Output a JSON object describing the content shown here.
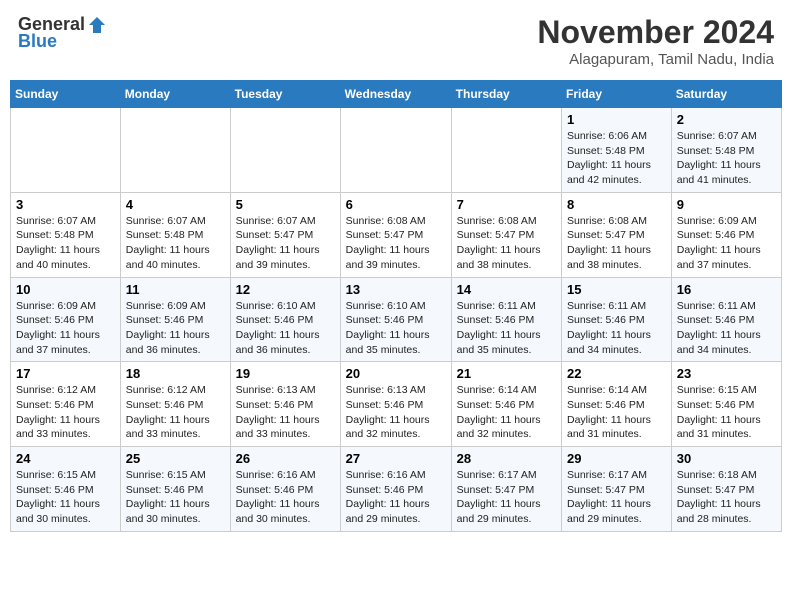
{
  "header": {
    "logo_general": "General",
    "logo_blue": "Blue",
    "month": "November 2024",
    "location": "Alagapuram, Tamil Nadu, India"
  },
  "weekdays": [
    "Sunday",
    "Monday",
    "Tuesday",
    "Wednesday",
    "Thursday",
    "Friday",
    "Saturday"
  ],
  "weeks": [
    [
      {
        "day": "",
        "info": ""
      },
      {
        "day": "",
        "info": ""
      },
      {
        "day": "",
        "info": ""
      },
      {
        "day": "",
        "info": ""
      },
      {
        "day": "",
        "info": ""
      },
      {
        "day": "1",
        "info": "Sunrise: 6:06 AM\nSunset: 5:48 PM\nDaylight: 11 hours\nand 42 minutes."
      },
      {
        "day": "2",
        "info": "Sunrise: 6:07 AM\nSunset: 5:48 PM\nDaylight: 11 hours\nand 41 minutes."
      }
    ],
    [
      {
        "day": "3",
        "info": "Sunrise: 6:07 AM\nSunset: 5:48 PM\nDaylight: 11 hours\nand 40 minutes."
      },
      {
        "day": "4",
        "info": "Sunrise: 6:07 AM\nSunset: 5:48 PM\nDaylight: 11 hours\nand 40 minutes."
      },
      {
        "day": "5",
        "info": "Sunrise: 6:07 AM\nSunset: 5:47 PM\nDaylight: 11 hours\nand 39 minutes."
      },
      {
        "day": "6",
        "info": "Sunrise: 6:08 AM\nSunset: 5:47 PM\nDaylight: 11 hours\nand 39 minutes."
      },
      {
        "day": "7",
        "info": "Sunrise: 6:08 AM\nSunset: 5:47 PM\nDaylight: 11 hours\nand 38 minutes."
      },
      {
        "day": "8",
        "info": "Sunrise: 6:08 AM\nSunset: 5:47 PM\nDaylight: 11 hours\nand 38 minutes."
      },
      {
        "day": "9",
        "info": "Sunrise: 6:09 AM\nSunset: 5:46 PM\nDaylight: 11 hours\nand 37 minutes."
      }
    ],
    [
      {
        "day": "10",
        "info": "Sunrise: 6:09 AM\nSunset: 5:46 PM\nDaylight: 11 hours\nand 37 minutes."
      },
      {
        "day": "11",
        "info": "Sunrise: 6:09 AM\nSunset: 5:46 PM\nDaylight: 11 hours\nand 36 minutes."
      },
      {
        "day": "12",
        "info": "Sunrise: 6:10 AM\nSunset: 5:46 PM\nDaylight: 11 hours\nand 36 minutes."
      },
      {
        "day": "13",
        "info": "Sunrise: 6:10 AM\nSunset: 5:46 PM\nDaylight: 11 hours\nand 35 minutes."
      },
      {
        "day": "14",
        "info": "Sunrise: 6:11 AM\nSunset: 5:46 PM\nDaylight: 11 hours\nand 35 minutes."
      },
      {
        "day": "15",
        "info": "Sunrise: 6:11 AM\nSunset: 5:46 PM\nDaylight: 11 hours\nand 34 minutes."
      },
      {
        "day": "16",
        "info": "Sunrise: 6:11 AM\nSunset: 5:46 PM\nDaylight: 11 hours\nand 34 minutes."
      }
    ],
    [
      {
        "day": "17",
        "info": "Sunrise: 6:12 AM\nSunset: 5:46 PM\nDaylight: 11 hours\nand 33 minutes."
      },
      {
        "day": "18",
        "info": "Sunrise: 6:12 AM\nSunset: 5:46 PM\nDaylight: 11 hours\nand 33 minutes."
      },
      {
        "day": "19",
        "info": "Sunrise: 6:13 AM\nSunset: 5:46 PM\nDaylight: 11 hours\nand 33 minutes."
      },
      {
        "day": "20",
        "info": "Sunrise: 6:13 AM\nSunset: 5:46 PM\nDaylight: 11 hours\nand 32 minutes."
      },
      {
        "day": "21",
        "info": "Sunrise: 6:14 AM\nSunset: 5:46 PM\nDaylight: 11 hours\nand 32 minutes."
      },
      {
        "day": "22",
        "info": "Sunrise: 6:14 AM\nSunset: 5:46 PM\nDaylight: 11 hours\nand 31 minutes."
      },
      {
        "day": "23",
        "info": "Sunrise: 6:15 AM\nSunset: 5:46 PM\nDaylight: 11 hours\nand 31 minutes."
      }
    ],
    [
      {
        "day": "24",
        "info": "Sunrise: 6:15 AM\nSunset: 5:46 PM\nDaylight: 11 hours\nand 30 minutes."
      },
      {
        "day": "25",
        "info": "Sunrise: 6:15 AM\nSunset: 5:46 PM\nDaylight: 11 hours\nand 30 minutes."
      },
      {
        "day": "26",
        "info": "Sunrise: 6:16 AM\nSunset: 5:46 PM\nDaylight: 11 hours\nand 30 minutes."
      },
      {
        "day": "27",
        "info": "Sunrise: 6:16 AM\nSunset: 5:46 PM\nDaylight: 11 hours\nand 29 minutes."
      },
      {
        "day": "28",
        "info": "Sunrise: 6:17 AM\nSunset: 5:47 PM\nDaylight: 11 hours\nand 29 minutes."
      },
      {
        "day": "29",
        "info": "Sunrise: 6:17 AM\nSunset: 5:47 PM\nDaylight: 11 hours\nand 29 minutes."
      },
      {
        "day": "30",
        "info": "Sunrise: 6:18 AM\nSunset: 5:47 PM\nDaylight: 11 hours\nand 28 minutes."
      }
    ]
  ]
}
